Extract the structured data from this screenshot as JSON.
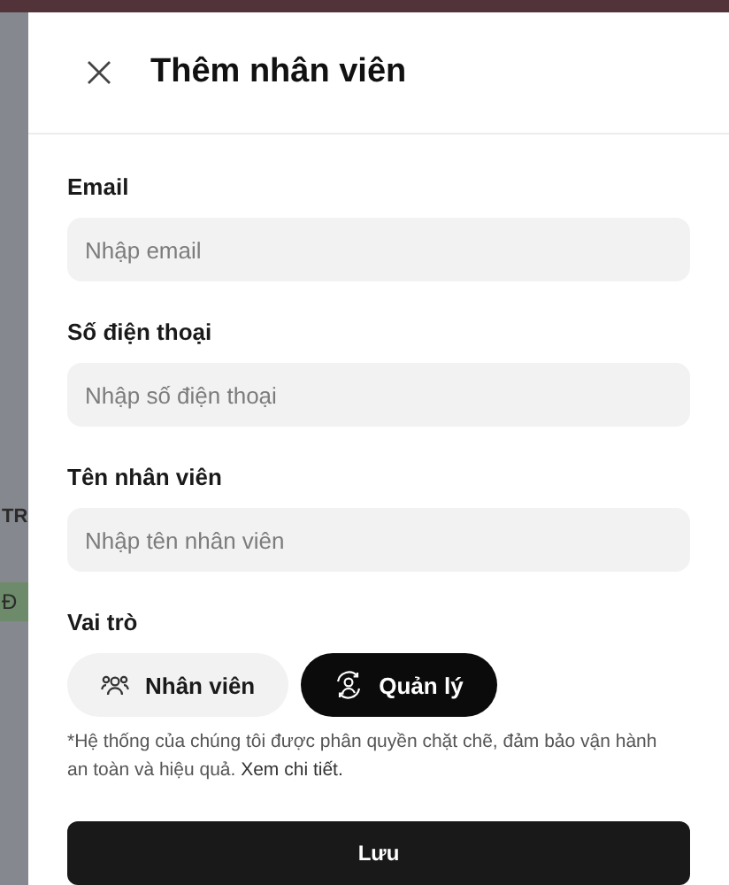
{
  "backdrop": {
    "texts": [
      {
        "text": "TR",
        "kind": "heading"
      },
      {
        "text": "Đ",
        "kind": "badge"
      }
    ]
  },
  "dialog": {
    "title": "Thêm nhân viên",
    "fields": [
      {
        "label": "Email",
        "placeholder": "Nhập email"
      },
      {
        "label": "Số điện thoại",
        "placeholder": "Nhập số điện thoại"
      },
      {
        "label": "Tên nhân viên",
        "placeholder": "Nhập tên nhân viên"
      }
    ],
    "role": {
      "label": "Vai trò",
      "options": [
        {
          "label": "Nhân viên",
          "kind": "staff",
          "selected": false
        },
        {
          "label": "Quản lý",
          "kind": "manager",
          "selected": true
        }
      ]
    },
    "note": "*Hệ thống của chúng tôi được phân quyền chặt chẽ, đảm bảo vận hành an toàn và hiệu quả.",
    "note_link": "Xem chi tiết.",
    "save_button": "Lưu"
  }
}
